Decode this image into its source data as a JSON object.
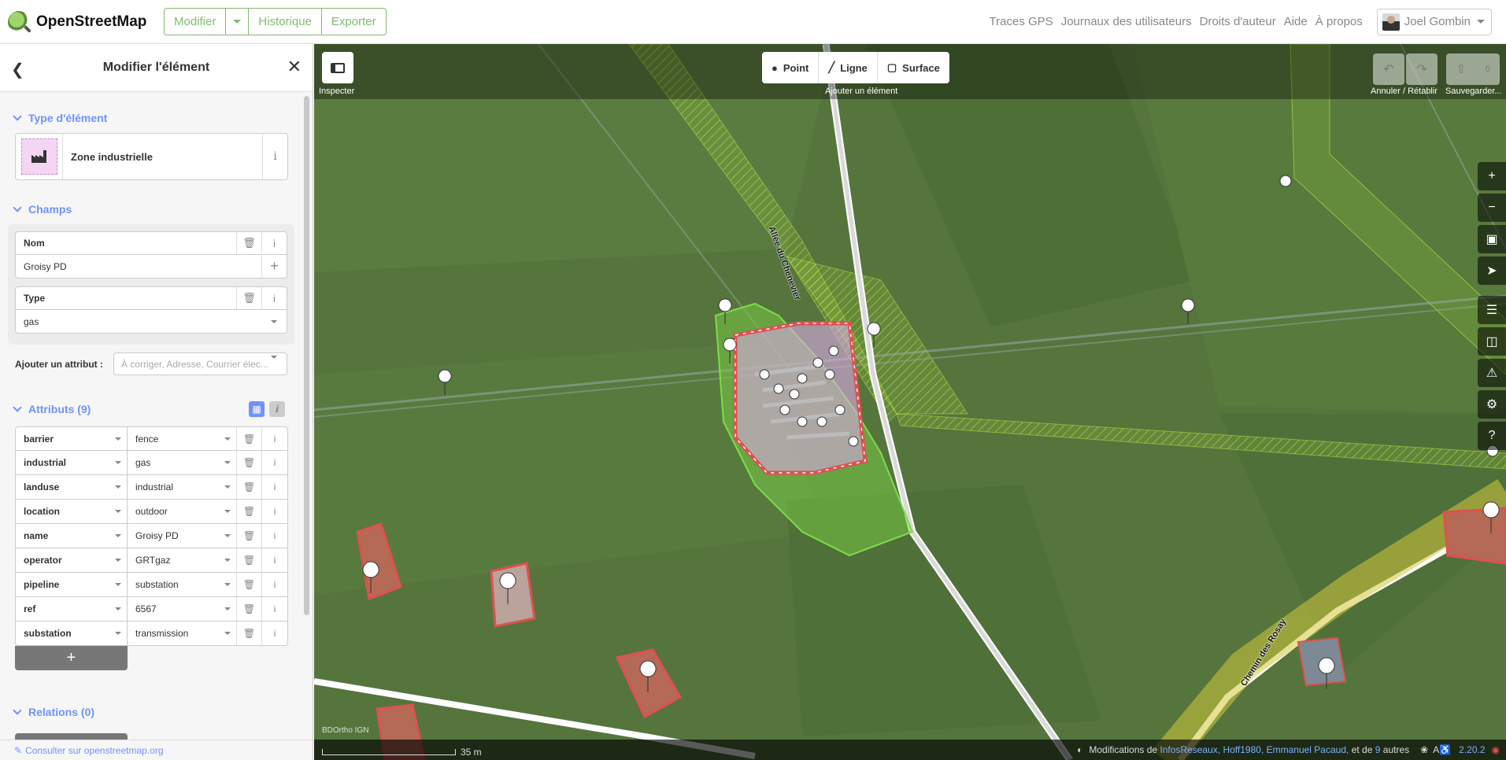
{
  "app": {
    "brand": "OpenStreetMap"
  },
  "topnav": {
    "edit": "Modifier",
    "history": "Historique",
    "export": "Exporter",
    "links": [
      "Traces GPS",
      "Journaux des utilisateurs",
      "Droits d'auteur",
      "Aide",
      "À propos"
    ],
    "user": "Joel Gombin"
  },
  "sidebar": {
    "title": "Modifier l'élément",
    "preset_section": "Type d'élément",
    "preset_name": "Zone industrielle",
    "fields_section": "Champs",
    "fields": [
      {
        "label": "Nom",
        "value": "Groisy PD"
      },
      {
        "label": "Type",
        "value": "gas"
      }
    ],
    "add_attribute_label": "Ajouter un attribut :",
    "add_attribute_placeholder": "À corriger, Adresse, Courrier élec...",
    "tags_section": "Attributs (9)",
    "tags": [
      {
        "k": "barrier",
        "v": "fence"
      },
      {
        "k": "industrial",
        "v": "gas"
      },
      {
        "k": "landuse",
        "v": "industrial"
      },
      {
        "k": "location",
        "v": "outdoor"
      },
      {
        "k": "name",
        "v": "Groisy PD"
      },
      {
        "k": "operator",
        "v": "GRTgaz"
      },
      {
        "k": "pipeline",
        "v": "substation"
      },
      {
        "k": "ref",
        "v": "6567"
      },
      {
        "k": "substation",
        "v": "transmission"
      }
    ],
    "relations_section": "Relations (0)",
    "footer_link": "Consulter sur openstreetmap.org"
  },
  "map": {
    "inspect_label": "Inspecter",
    "add_point": "Point",
    "add_line": "Ligne",
    "add_area": "Surface",
    "add_label": "Ajouter un élément",
    "undo_label": "Annuler / Rétablir",
    "save_label": "Sauvegarder...",
    "save_count": "0",
    "street_1": "Allée du Chenevier",
    "street_2": "Chemin des Rosay",
    "imagery": "BDOrtho IGN",
    "scale": "35 m",
    "attribution_prefix": "Modifications de",
    "attribution_users": "InfosReseaux, Hoff1980, Emmanuel Pacaud,",
    "attribution_and": "et de",
    "attribution_count": "9",
    "attribution_suffix": "autres",
    "version": "2.20.2"
  }
}
